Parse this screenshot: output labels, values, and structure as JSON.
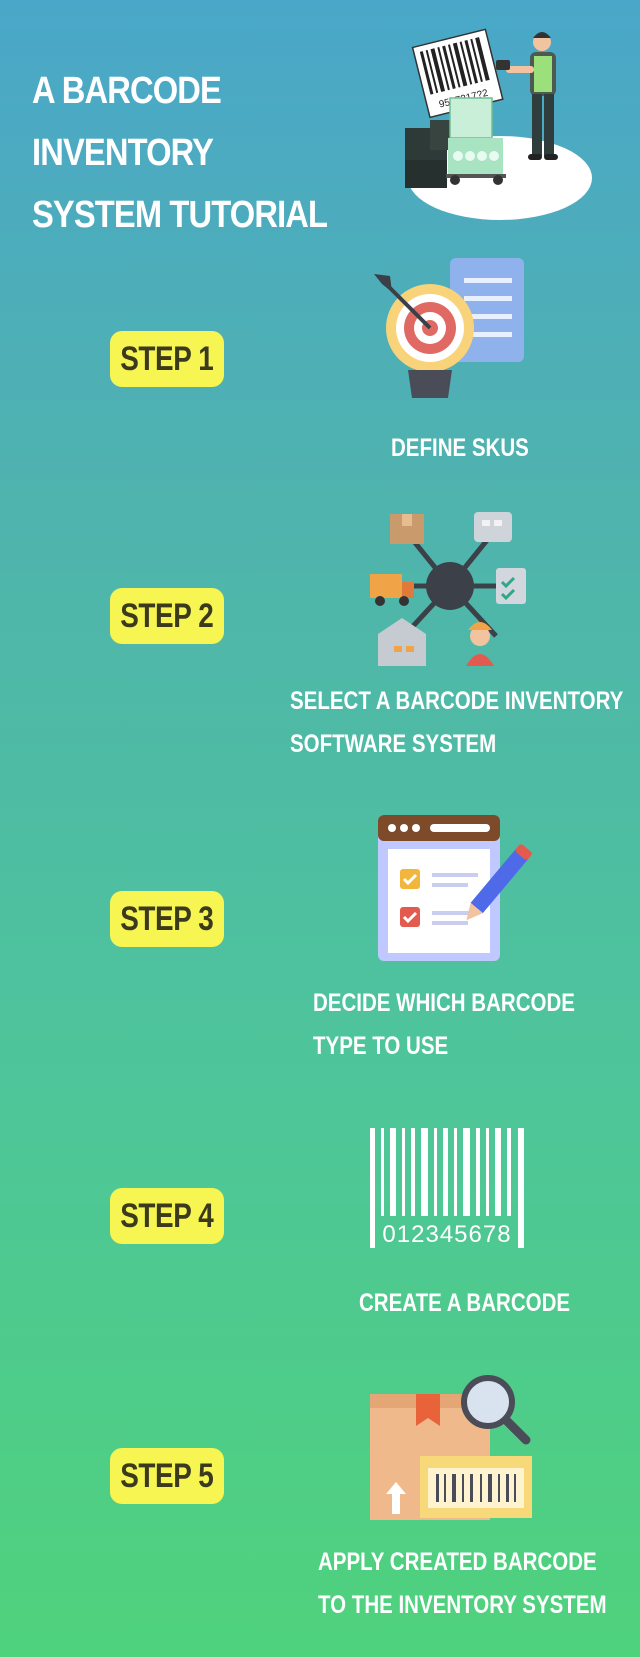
{
  "header": {
    "title_line1": "A BARCODE INVENTORY",
    "title_line2": "SYSTEM TUTORIAL",
    "hero_barcode_number": "9507217?2"
  },
  "steps": [
    {
      "badge": "STEP 1",
      "lines": [
        "DEFINE SKUS"
      ],
      "icon": "target-lightbulb-icon"
    },
    {
      "badge": "STEP 2",
      "lines": [
        "SELECT A BARCODE INVENTORY",
        "SOFTWARE SYSTEM"
      ],
      "icon": "network-hub-icon"
    },
    {
      "badge": "STEP 3",
      "lines": [
        "DECIDE WHICH BARCODE",
        "TYPE TO USE"
      ],
      "icon": "checklist-pencil-icon"
    },
    {
      "badge": "STEP 4",
      "lines": [
        "CREATE A BARCODE"
      ],
      "icon": "barcode-icon",
      "barcode_number": "012345678"
    },
    {
      "badge": "STEP 5",
      "lines": [
        "APPLY CREATED BARCODE",
        "TO THE INVENTORY SYSTEM"
      ],
      "icon": "box-scan-icon"
    }
  ],
  "colors": {
    "background_top": "#4aa7c9",
    "background_bottom": "#4fd27c",
    "badge": "#f6f552",
    "badge_text": "#3b3a1c",
    "text": "#ffffff"
  }
}
